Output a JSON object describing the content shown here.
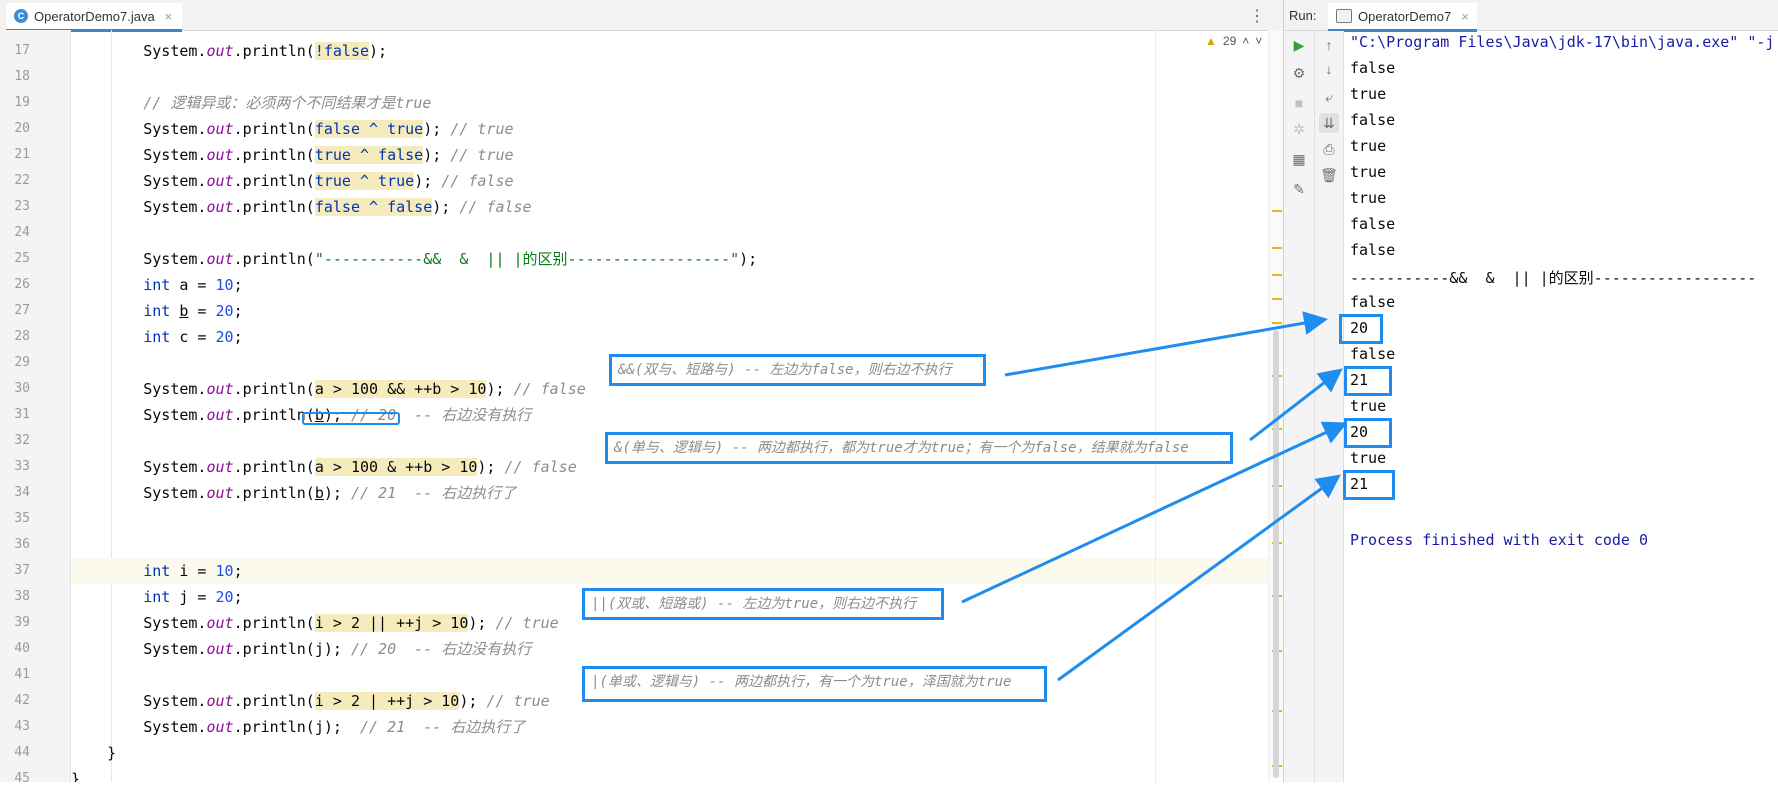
{
  "editor": {
    "tab_label": "OperatorDemo7.java",
    "tab_close": "×",
    "file_icon": "C",
    "more_icon": "⋮",
    "warnings": "29"
  },
  "lines": [
    {
      "n": "17",
      "code": [
        [
          "        System.",
          "t"
        ],
        [
          "out",
          "f"
        ],
        [
          ".println(",
          "t"
        ],
        [
          "!false",
          "khl"
        ],
        [
          ");",
          "t"
        ]
      ]
    },
    {
      "n": "18",
      "code": []
    },
    {
      "n": "19",
      "code": [
        [
          "        // 逻辑异或：必须两个不同结果才是true",
          "c"
        ]
      ]
    },
    {
      "n": "20",
      "code": [
        [
          "        System.",
          "t"
        ],
        [
          "out",
          "f"
        ],
        [
          ".println(",
          "t"
        ],
        [
          "false ^ true",
          "khl"
        ],
        [
          "); ",
          "t"
        ],
        [
          "// true",
          "c"
        ]
      ]
    },
    {
      "n": "21",
      "code": [
        [
          "        System.",
          "t"
        ],
        [
          "out",
          "f"
        ],
        [
          ".println(",
          "t"
        ],
        [
          "true ^ false",
          "khl"
        ],
        [
          "); ",
          "t"
        ],
        [
          "// true",
          "c"
        ]
      ]
    },
    {
      "n": "22",
      "code": [
        [
          "        System.",
          "t"
        ],
        [
          "out",
          "f"
        ],
        [
          ".println(",
          "t"
        ],
        [
          "true ^ true",
          "khl"
        ],
        [
          "); ",
          "t"
        ],
        [
          "// false",
          "c"
        ]
      ]
    },
    {
      "n": "23",
      "code": [
        [
          "        System.",
          "t"
        ],
        [
          "out",
          "f"
        ],
        [
          ".println(",
          "t"
        ],
        [
          "false ^ false",
          "khl"
        ],
        [
          "); ",
          "t"
        ],
        [
          "// false",
          "c"
        ]
      ]
    },
    {
      "n": "24",
      "code": []
    },
    {
      "n": "25",
      "code": [
        [
          "        System.",
          "t"
        ],
        [
          "out",
          "f"
        ],
        [
          ".println(",
          "t"
        ],
        [
          "\"-----------&&  &  || |的区别------------------\"",
          "s"
        ],
        [
          ");",
          "t"
        ]
      ]
    },
    {
      "n": "26",
      "code": [
        [
          "        ",
          "t"
        ],
        [
          "int",
          "k"
        ],
        [
          " a = ",
          "t"
        ],
        [
          "10",
          "n"
        ],
        [
          ";",
          "t"
        ]
      ]
    },
    {
      "n": "27",
      "code": [
        [
          "        ",
          "t"
        ],
        [
          "int",
          "k"
        ],
        [
          " ",
          "t"
        ],
        [
          "b",
          "u"
        ],
        [
          " = ",
          "t"
        ],
        [
          "20",
          "n"
        ],
        [
          ";",
          "t"
        ]
      ]
    },
    {
      "n": "28",
      "code": [
        [
          "        ",
          "t"
        ],
        [
          "int",
          "k"
        ],
        [
          " c = ",
          "t"
        ],
        [
          "20",
          "n"
        ],
        [
          ";",
          "t"
        ]
      ]
    },
    {
      "n": "29",
      "code": []
    },
    {
      "n": "30",
      "code": [
        [
          "        System.",
          "t"
        ],
        [
          "out",
          "f"
        ],
        [
          ".println(",
          "t"
        ],
        [
          "a > 100 && ++b > 10",
          "nhl"
        ],
        [
          "); ",
          "t"
        ],
        [
          "// false",
          "c"
        ]
      ]
    },
    {
      "n": "31",
      "code": [
        [
          "        System.",
          "t"
        ],
        [
          "out",
          "f"
        ],
        [
          ".println(",
          "t"
        ],
        [
          "b",
          "u"
        ],
        [
          "); ",
          "t"
        ],
        [
          "// 20  -- 右边没有执行",
          "c"
        ]
      ]
    },
    {
      "n": "32",
      "code": []
    },
    {
      "n": "33",
      "code": [
        [
          "        System.",
          "t"
        ],
        [
          "out",
          "f"
        ],
        [
          ".println(",
          "t"
        ],
        [
          "a > 100 & ++b > 10",
          "nhl"
        ],
        [
          "); ",
          "t"
        ],
        [
          "// false",
          "c"
        ]
      ]
    },
    {
      "n": "34",
      "code": [
        [
          "        System.",
          "t"
        ],
        [
          "out",
          "f"
        ],
        [
          ".println(",
          "t"
        ],
        [
          "b",
          "u"
        ],
        [
          "); ",
          "t"
        ],
        [
          "// 21  -- 右边执行了",
          "c"
        ]
      ]
    },
    {
      "n": "35",
      "code": []
    },
    {
      "n": "36",
      "code": []
    },
    {
      "n": "37",
      "code": [
        [
          "        ",
          "t"
        ],
        [
          "int",
          "k"
        ],
        [
          " i = ",
          "t"
        ],
        [
          "10",
          "n"
        ],
        [
          ";",
          "t"
        ]
      ],
      "current": true
    },
    {
      "n": "38",
      "code": [
        [
          "        ",
          "t"
        ],
        [
          "int",
          "k"
        ],
        [
          " j = ",
          "t"
        ],
        [
          "20",
          "n"
        ],
        [
          ";",
          "t"
        ]
      ]
    },
    {
      "n": "39",
      "code": [
        [
          "        System.",
          "t"
        ],
        [
          "out",
          "f"
        ],
        [
          ".println(",
          "t"
        ],
        [
          "i > 2 || ++j > 10",
          "nhl"
        ],
        [
          "); ",
          "t"
        ],
        [
          "// true",
          "c"
        ]
      ]
    },
    {
      "n": "40",
      "code": [
        [
          "        System.",
          "t"
        ],
        [
          "out",
          "f"
        ],
        [
          ".println(j); ",
          "t"
        ],
        [
          "// 20  -- 右边没有执行",
          "c"
        ]
      ]
    },
    {
      "n": "41",
      "code": []
    },
    {
      "n": "42",
      "code": [
        [
          "        System.",
          "t"
        ],
        [
          "out",
          "f"
        ],
        [
          ".println(",
          "t"
        ],
        [
          "i > 2 | ++j > 10",
          "nhl"
        ],
        [
          "); ",
          "t"
        ],
        [
          "// true",
          "c"
        ]
      ]
    },
    {
      "n": "43",
      "code": [
        [
          "        System.",
          "t"
        ],
        [
          "out",
          "f"
        ],
        [
          ".println(j);  ",
          "t"
        ],
        [
          "// 21  -- 右边执行了",
          "c"
        ]
      ]
    },
    {
      "n": "44",
      "code": [
        [
          "    }",
          "t"
        ]
      ]
    },
    {
      "n": "45",
      "code": [
        [
          "}",
          "t"
        ]
      ]
    }
  ],
  "annotations": {
    "and_short": "&&(双与、短路与)  -- 左边为false，则右边不执行",
    "and_logic": "&(单与、逻辑与) -- 两边都执行，都为true才为true；有一个为false，结果就为false",
    "or_short": "||(双或、短路或) -- 左边为true，则右边不执行",
    "or_logic": "|(单或、逻辑与) -- 两边都执行，有一个为true，泽国就为true"
  },
  "run": {
    "label": "Run:",
    "tab_label": "OperatorDemo7",
    "tab_close": "×",
    "command": "\"C:\\Program Files\\Java\\jdk-17\\bin\\java.exe\" \"-j",
    "output": [
      "false",
      "true",
      "false",
      "true",
      "true",
      "true",
      "false",
      "false",
      "-----------&&  &  || |的区别------------------",
      "false",
      "20",
      "false",
      "21",
      "true",
      "20",
      "true",
      "21",
      ""
    ],
    "exit": "Process finished with exit code 0"
  },
  "colors": {
    "accent": "#1f8cf0",
    "keyword": "#0033b3",
    "number": "#1750eb",
    "string": "#067d17",
    "comment": "#8c8c8c",
    "field": "#871094"
  },
  "icons": [
    "run-icon",
    "rerun-up-icon",
    "rerun-down-icon",
    "wrench-icon",
    "stop-icon",
    "soft-wrap-icon",
    "scroll-to-end-icon",
    "print-icon",
    "delete-icon",
    "layout-icon",
    "pin-icon",
    "warning-icon"
  ]
}
